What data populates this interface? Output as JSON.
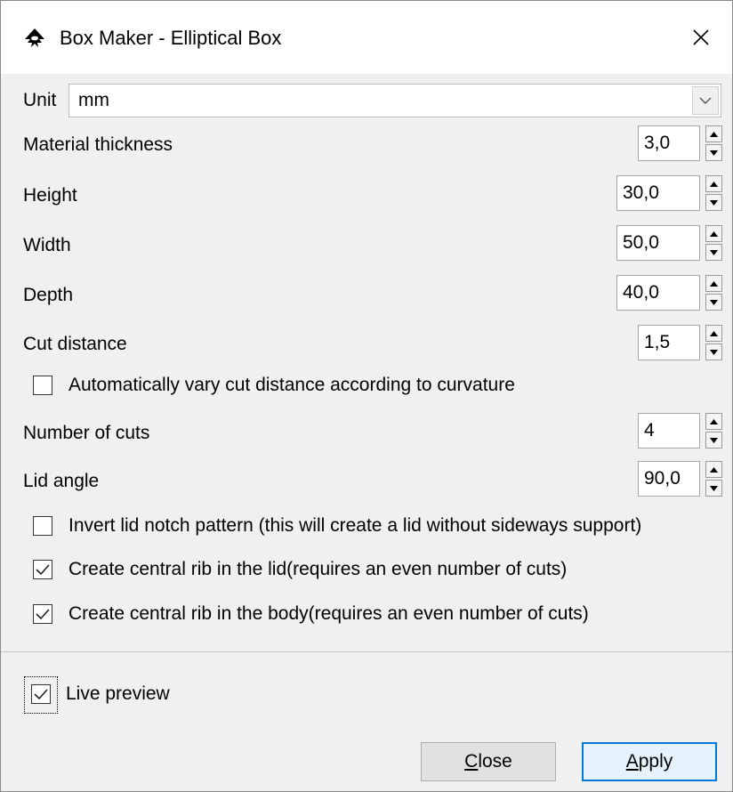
{
  "window": {
    "title": "Box Maker - Elliptical Box"
  },
  "unit": {
    "label": "Unit",
    "value": "mm"
  },
  "fields": [
    {
      "label": "Material thickness",
      "value": "3,0"
    },
    {
      "label": "Height",
      "value": "30,0"
    },
    {
      "label": "Width",
      "value": "50,0"
    },
    {
      "label": "Depth",
      "value": "40,0"
    },
    {
      "label": "Cut distance",
      "value": "1,5"
    },
    {
      "label": "Number of cuts",
      "value": "4"
    },
    {
      "label": "Lid angle",
      "value": "90,0"
    }
  ],
  "checkboxes": [
    {
      "label": "Automatically vary cut distance according to curvature",
      "checked": false
    },
    {
      "label": "Invert lid notch pattern (this will create a lid without sideways support)",
      "checked": false
    },
    {
      "label": "Create central rib in the lid(requires an even number of cuts)",
      "checked": true
    },
    {
      "label": "Create central rib in the body(requires an even number of cuts)",
      "checked": true
    }
  ],
  "live_preview": {
    "label": "Live preview",
    "checked": true
  },
  "buttons": {
    "close_mnemonic": "C",
    "close_rest": "lose",
    "apply_mnemonic": "A",
    "apply_rest": "pply"
  },
  "colors": {
    "accent": "#0078d7",
    "dialog_bg": "#f0f0f0"
  }
}
